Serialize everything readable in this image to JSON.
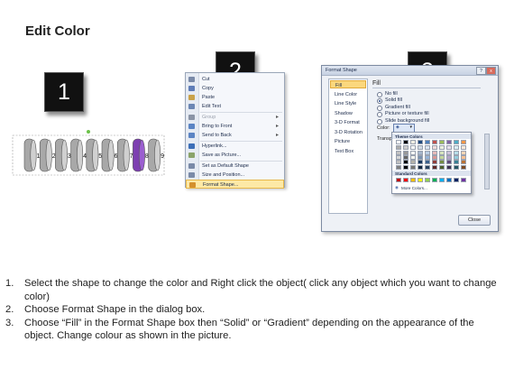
{
  "title": "Edit Color",
  "badges": [
    "1",
    "2",
    "3"
  ],
  "panel1": {
    "numbers": [
      "1",
      "2",
      "3",
      "4",
      "5",
      "6",
      "7",
      "8",
      "9"
    ],
    "highlight_index": 7,
    "highlight_color": "#7d3fb1",
    "shape_color": "#a8a8a8"
  },
  "context_menu": {
    "items": [
      {
        "label": "Cut",
        "dim": false,
        "arrow": false
      },
      {
        "label": "Copy",
        "dim": false,
        "arrow": false
      },
      {
        "label": "Paste",
        "dim": false,
        "arrow": false
      },
      {
        "label": "Edit Text",
        "dim": false,
        "arrow": false
      },
      {
        "label": "Group",
        "dim": true,
        "arrow": true
      },
      {
        "label": "Bring to Front",
        "dim": false,
        "arrow": true
      },
      {
        "label": "Send to Back",
        "dim": false,
        "arrow": true
      },
      {
        "label": "Hyperlink...",
        "dim": false,
        "arrow": false
      },
      {
        "label": "Save as Picture...",
        "dim": false,
        "arrow": false
      },
      {
        "label": "Set as Default Shape",
        "dim": false,
        "arrow": false
      },
      {
        "label": "Size and Position...",
        "dim": false,
        "arrow": false
      },
      {
        "label": "Format Shape...",
        "dim": false,
        "arrow": false,
        "highlight": true
      }
    ]
  },
  "dialog": {
    "title": "Format Shape",
    "help": "?",
    "close_x": "x",
    "nav_items": [
      "Fill",
      "Line Color",
      "Line Style",
      "Shadow",
      "3-D Format",
      "3-D Rotation",
      "Picture",
      "Text Box"
    ],
    "selected_nav": "Fill",
    "section_title": "Fill",
    "options": [
      {
        "label": "No fill",
        "checked": false
      },
      {
        "label": "Solid fill",
        "checked": true
      },
      {
        "label": "Gradient fill",
        "checked": false
      },
      {
        "label": "Picture or texture fill",
        "checked": false
      },
      {
        "label": "Slide background fill",
        "checked": false
      }
    ],
    "color_label": "Color:",
    "transparency_label": "Transpa",
    "close_button": "Close"
  },
  "palette": {
    "theme_title": "Theme Colors",
    "standard_title": "Standard Colors",
    "more_colors": "More Colors...",
    "theme_top": [
      "#ffffff",
      "#000000",
      "#eeece1",
      "#1f497d",
      "#4f81bd",
      "#c0504d",
      "#9bbb59",
      "#8064a2",
      "#4bacc6",
      "#f79646"
    ],
    "standard": [
      "#c00000",
      "#ff0000",
      "#ffc000",
      "#ffff00",
      "#92d050",
      "#00b050",
      "#00b0f0",
      "#0070c0",
      "#002060",
      "#7030a0"
    ]
  },
  "steps": [
    {
      "num": "1.",
      "text": "Select the shape to change the color and Right click the object( click any object which you want to change color)"
    },
    {
      "num": "2.",
      "text": "Choose Format Shape in the dialog box."
    },
    {
      "num": "3.",
      "text": "Choose “Fill” in the Format Shape box then “Solid” or “Gradient” depending on the appearance of the object. Change colour as shown in the picture."
    }
  ]
}
